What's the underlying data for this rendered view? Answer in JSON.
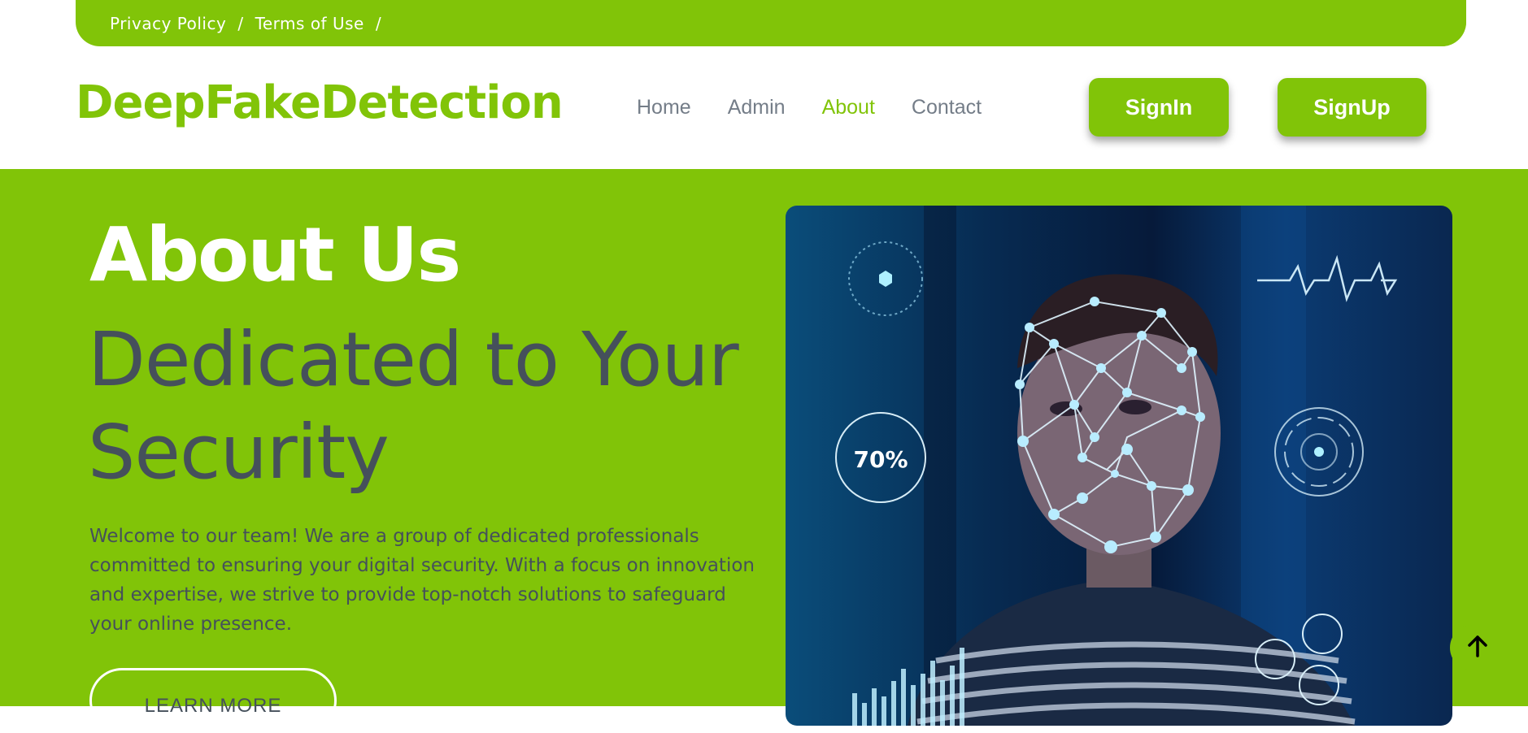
{
  "topbar": {
    "links": [
      "Privacy Policy",
      "Terms of Use"
    ],
    "separator": "/"
  },
  "header": {
    "brand": "DeepFakeDetection",
    "nav": [
      {
        "label": "Home",
        "active": false
      },
      {
        "label": "Admin",
        "active": false
      },
      {
        "label": "About",
        "active": true
      },
      {
        "label": "Contact",
        "active": false
      }
    ],
    "signin_label": "SignIn",
    "signup_label": "SignUp"
  },
  "hero": {
    "title": "About Us",
    "subtitle": "Dedicated to Your Security",
    "body": "Welcome to our team! We are a group of dedicated professionals committed to ensuring your digital security. With a focus on innovation and expertise, we strive to provide top-notch solutions to safeguard your online presence.",
    "button_label": "LEARN MORE",
    "image": {
      "overlay_percent_label": "70%"
    }
  },
  "icons": {
    "back_to_top": "arrow-up-icon"
  },
  "colors": {
    "accent": "#81c408",
    "text_dark": "#45505b",
    "nav_text": "#747d88"
  }
}
